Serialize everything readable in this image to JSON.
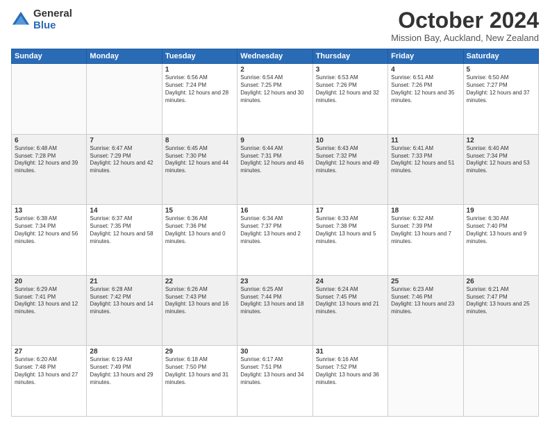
{
  "logo": {
    "general": "General",
    "blue": "Blue"
  },
  "header": {
    "title": "October 2024",
    "subtitle": "Mission Bay, Auckland, New Zealand"
  },
  "weekdays": [
    "Sunday",
    "Monday",
    "Tuesday",
    "Wednesday",
    "Thursday",
    "Friday",
    "Saturday"
  ],
  "weeks": [
    [
      {
        "day": "",
        "sunrise": "",
        "sunset": "",
        "daylight": ""
      },
      {
        "day": "",
        "sunrise": "",
        "sunset": "",
        "daylight": ""
      },
      {
        "day": "1",
        "sunrise": "Sunrise: 6:56 AM",
        "sunset": "Sunset: 7:24 PM",
        "daylight": "Daylight: 12 hours and 28 minutes."
      },
      {
        "day": "2",
        "sunrise": "Sunrise: 6:54 AM",
        "sunset": "Sunset: 7:25 PM",
        "daylight": "Daylight: 12 hours and 30 minutes."
      },
      {
        "day": "3",
        "sunrise": "Sunrise: 6:53 AM",
        "sunset": "Sunset: 7:26 PM",
        "daylight": "Daylight: 12 hours and 32 minutes."
      },
      {
        "day": "4",
        "sunrise": "Sunrise: 6:51 AM",
        "sunset": "Sunset: 7:26 PM",
        "daylight": "Daylight: 12 hours and 35 minutes."
      },
      {
        "day": "5",
        "sunrise": "Sunrise: 6:50 AM",
        "sunset": "Sunset: 7:27 PM",
        "daylight": "Daylight: 12 hours and 37 minutes."
      }
    ],
    [
      {
        "day": "6",
        "sunrise": "Sunrise: 6:48 AM",
        "sunset": "Sunset: 7:28 PM",
        "daylight": "Daylight: 12 hours and 39 minutes."
      },
      {
        "day": "7",
        "sunrise": "Sunrise: 6:47 AM",
        "sunset": "Sunset: 7:29 PM",
        "daylight": "Daylight: 12 hours and 42 minutes."
      },
      {
        "day": "8",
        "sunrise": "Sunrise: 6:45 AM",
        "sunset": "Sunset: 7:30 PM",
        "daylight": "Daylight: 12 hours and 44 minutes."
      },
      {
        "day": "9",
        "sunrise": "Sunrise: 6:44 AM",
        "sunset": "Sunset: 7:31 PM",
        "daylight": "Daylight: 12 hours and 46 minutes."
      },
      {
        "day": "10",
        "sunrise": "Sunrise: 6:43 AM",
        "sunset": "Sunset: 7:32 PM",
        "daylight": "Daylight: 12 hours and 49 minutes."
      },
      {
        "day": "11",
        "sunrise": "Sunrise: 6:41 AM",
        "sunset": "Sunset: 7:33 PM",
        "daylight": "Daylight: 12 hours and 51 minutes."
      },
      {
        "day": "12",
        "sunrise": "Sunrise: 6:40 AM",
        "sunset": "Sunset: 7:34 PM",
        "daylight": "Daylight: 12 hours and 53 minutes."
      }
    ],
    [
      {
        "day": "13",
        "sunrise": "Sunrise: 6:38 AM",
        "sunset": "Sunset: 7:34 PM",
        "daylight": "Daylight: 12 hours and 56 minutes."
      },
      {
        "day": "14",
        "sunrise": "Sunrise: 6:37 AM",
        "sunset": "Sunset: 7:35 PM",
        "daylight": "Daylight: 12 hours and 58 minutes."
      },
      {
        "day": "15",
        "sunrise": "Sunrise: 6:36 AM",
        "sunset": "Sunset: 7:36 PM",
        "daylight": "Daylight: 13 hours and 0 minutes."
      },
      {
        "day": "16",
        "sunrise": "Sunrise: 6:34 AM",
        "sunset": "Sunset: 7:37 PM",
        "daylight": "Daylight: 13 hours and 2 minutes."
      },
      {
        "day": "17",
        "sunrise": "Sunrise: 6:33 AM",
        "sunset": "Sunset: 7:38 PM",
        "daylight": "Daylight: 13 hours and 5 minutes."
      },
      {
        "day": "18",
        "sunrise": "Sunrise: 6:32 AM",
        "sunset": "Sunset: 7:39 PM",
        "daylight": "Daylight: 13 hours and 7 minutes."
      },
      {
        "day": "19",
        "sunrise": "Sunrise: 6:30 AM",
        "sunset": "Sunset: 7:40 PM",
        "daylight": "Daylight: 13 hours and 9 minutes."
      }
    ],
    [
      {
        "day": "20",
        "sunrise": "Sunrise: 6:29 AM",
        "sunset": "Sunset: 7:41 PM",
        "daylight": "Daylight: 13 hours and 12 minutes."
      },
      {
        "day": "21",
        "sunrise": "Sunrise: 6:28 AM",
        "sunset": "Sunset: 7:42 PM",
        "daylight": "Daylight: 13 hours and 14 minutes."
      },
      {
        "day": "22",
        "sunrise": "Sunrise: 6:26 AM",
        "sunset": "Sunset: 7:43 PM",
        "daylight": "Daylight: 13 hours and 16 minutes."
      },
      {
        "day": "23",
        "sunrise": "Sunrise: 6:25 AM",
        "sunset": "Sunset: 7:44 PM",
        "daylight": "Daylight: 13 hours and 18 minutes."
      },
      {
        "day": "24",
        "sunrise": "Sunrise: 6:24 AM",
        "sunset": "Sunset: 7:45 PM",
        "daylight": "Daylight: 13 hours and 21 minutes."
      },
      {
        "day": "25",
        "sunrise": "Sunrise: 6:23 AM",
        "sunset": "Sunset: 7:46 PM",
        "daylight": "Daylight: 13 hours and 23 minutes."
      },
      {
        "day": "26",
        "sunrise": "Sunrise: 6:21 AM",
        "sunset": "Sunset: 7:47 PM",
        "daylight": "Daylight: 13 hours and 25 minutes."
      }
    ],
    [
      {
        "day": "27",
        "sunrise": "Sunrise: 6:20 AM",
        "sunset": "Sunset: 7:48 PM",
        "daylight": "Daylight: 13 hours and 27 minutes."
      },
      {
        "day": "28",
        "sunrise": "Sunrise: 6:19 AM",
        "sunset": "Sunset: 7:49 PM",
        "daylight": "Daylight: 13 hours and 29 minutes."
      },
      {
        "day": "29",
        "sunrise": "Sunrise: 6:18 AM",
        "sunset": "Sunset: 7:50 PM",
        "daylight": "Daylight: 13 hours and 31 minutes."
      },
      {
        "day": "30",
        "sunrise": "Sunrise: 6:17 AM",
        "sunset": "Sunset: 7:51 PM",
        "daylight": "Daylight: 13 hours and 34 minutes."
      },
      {
        "day": "31",
        "sunrise": "Sunrise: 6:16 AM",
        "sunset": "Sunset: 7:52 PM",
        "daylight": "Daylight: 13 hours and 36 minutes."
      },
      {
        "day": "",
        "sunrise": "",
        "sunset": "",
        "daylight": ""
      },
      {
        "day": "",
        "sunrise": "",
        "sunset": "",
        "daylight": ""
      }
    ]
  ]
}
